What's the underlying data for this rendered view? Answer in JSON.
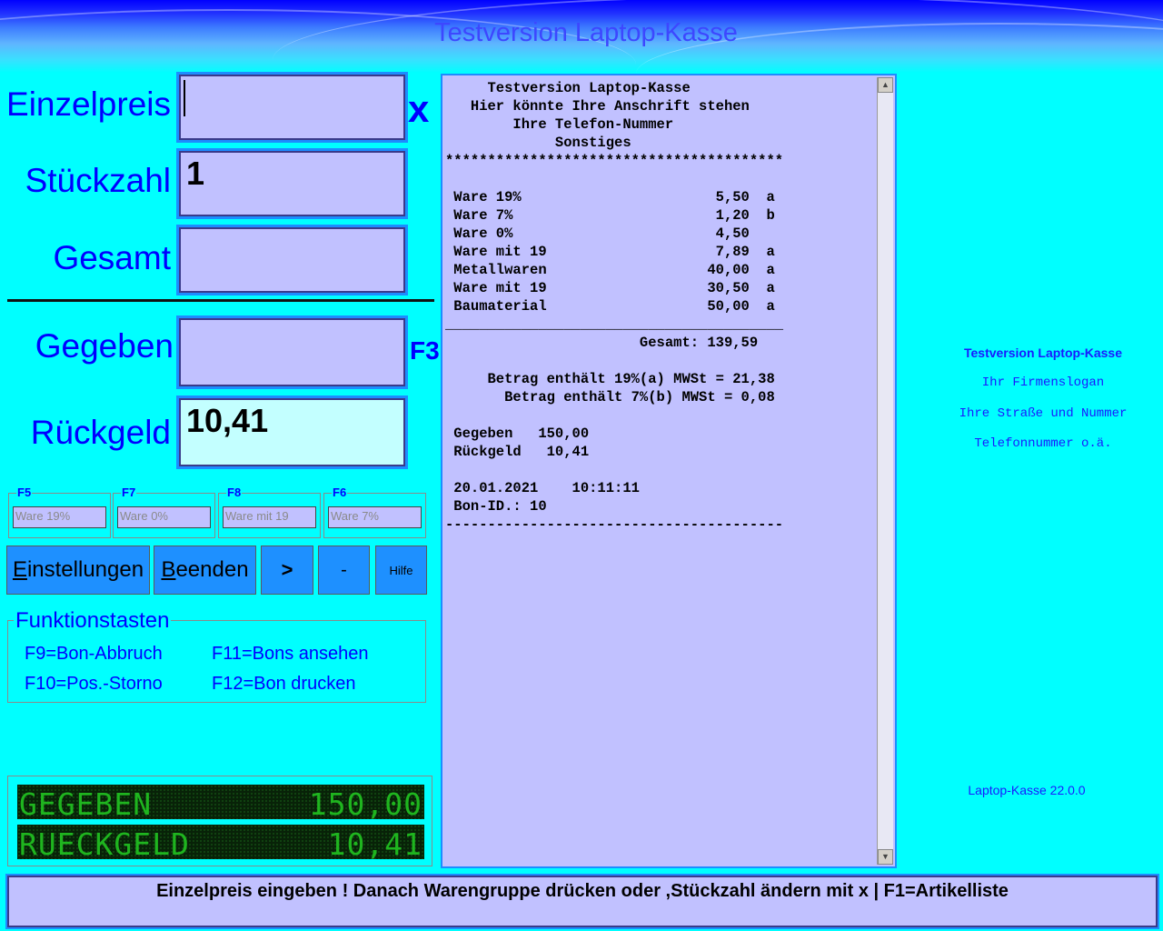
{
  "app": {
    "title": "Testversion Laptop-Kasse"
  },
  "form": {
    "einzelpreis": {
      "label": "Einzelpreis",
      "value": ""
    },
    "stueckzahl": {
      "label": "Stückzahl",
      "value": "1"
    },
    "gesamt": {
      "label": "Gesamt",
      "value": ""
    },
    "gegeben": {
      "label": "Gegeben",
      "value": ""
    },
    "rueckgeld": {
      "label": "Rückgeld",
      "value": "10,41"
    },
    "multiply_mark": "x",
    "gegeben_key": "F3"
  },
  "warengruppen": [
    {
      "key": "F5",
      "label": "Ware 19%"
    },
    {
      "key": "F7",
      "label": "Ware 0%"
    },
    {
      "key": "F8",
      "label": "Ware mit 19"
    },
    {
      "key": "F6",
      "label": "Ware 7%"
    }
  ],
  "buttons": {
    "settings_access": "E",
    "settings_rest": "instellungen",
    "quit_access": "B",
    "quit_rest": "eenden",
    "next": ">",
    "minus": "-",
    "help": "Hilfe"
  },
  "funktionstasten": {
    "legend": "Funktionstasten",
    "items": [
      "F9=Bon-Abbruch",
      "F11=Bons ansehen",
      "F10=Pos.-Storno",
      "F12=Bon drucken"
    ]
  },
  "display": {
    "row1_label": "GEGEBEN",
    "row1_value": "150,00",
    "row2_label": "RUECKGELD",
    "row2_value": "10,41"
  },
  "receipt": {
    "lines": [
      "     Testversion Laptop-Kasse",
      "   Hier könnte Ihre Anschrift stehen",
      "        Ihre Telefon-Nummer",
      "             Sonstiges",
      "****************************************",
      "",
      " Ware 19%                       5,50  a",
      " Ware 7%                        1,20  b",
      " Ware 0%                        4,50",
      " Ware mit 19                    7,89  a",
      " Metallwaren                   40,00  a",
      " Ware mit 19                   30,50  a",
      " Baumaterial                   50,00  a",
      "________________________________________",
      "                       Gesamt: 139,59",
      "",
      "     Betrag enthält 19%(a) MWSt = 21,38",
      "       Betrag enthält 7%(b) MWSt = 0,08",
      "",
      " Gegeben   150,00",
      " Rückgeld   10,41",
      "",
      " 20.01.2021    10:11:11",
      " Bon-ID.: 10",
      "----------------------------------------"
    ]
  },
  "right_panel": {
    "title": "Testversion Laptop-Kasse",
    "slogan": "Ihr Firmenslogan",
    "street": "Ihre Straße und Nummer",
    "phone": "Telefonnummer o.ä.",
    "version": "Laptop-Kasse 22.0.0"
  },
  "status": {
    "text": "Einzelpreis eingeben ! Danach Warengruppe drücken oder ,Stückzahl ändern mit x  |  F1=Artikelliste"
  }
}
